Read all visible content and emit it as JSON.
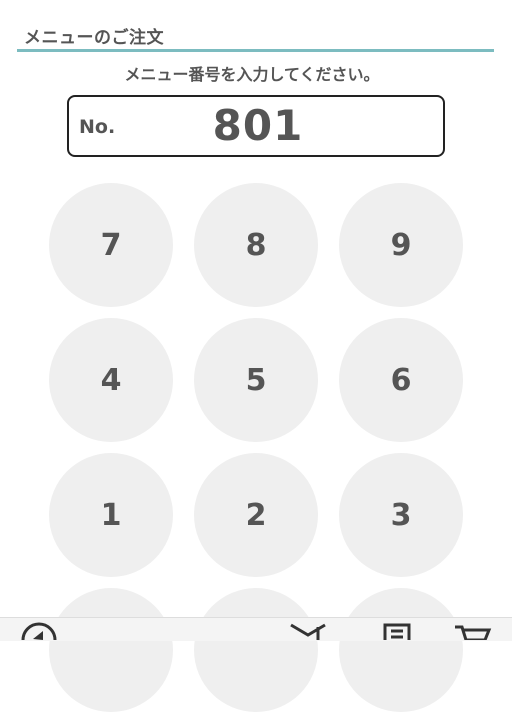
{
  "header": {
    "title": "メニューのご注文"
  },
  "instruction": "メニュー番号を入力してください。",
  "display": {
    "label": "No.",
    "value": "801"
  },
  "keypad": {
    "keys": [
      "7",
      "8",
      "9",
      "4",
      "5",
      "6",
      "1",
      "2",
      "3",
      "",
      "",
      ""
    ]
  },
  "bottom_nav": {
    "icons": [
      "back-icon",
      "ticket-icon",
      "receipt-icon",
      "cart-icon"
    ]
  },
  "colors": {
    "accent_rule": "#7cbcc0",
    "key_bg": "#efefef",
    "text": "#555555",
    "display_border": "#222222"
  }
}
